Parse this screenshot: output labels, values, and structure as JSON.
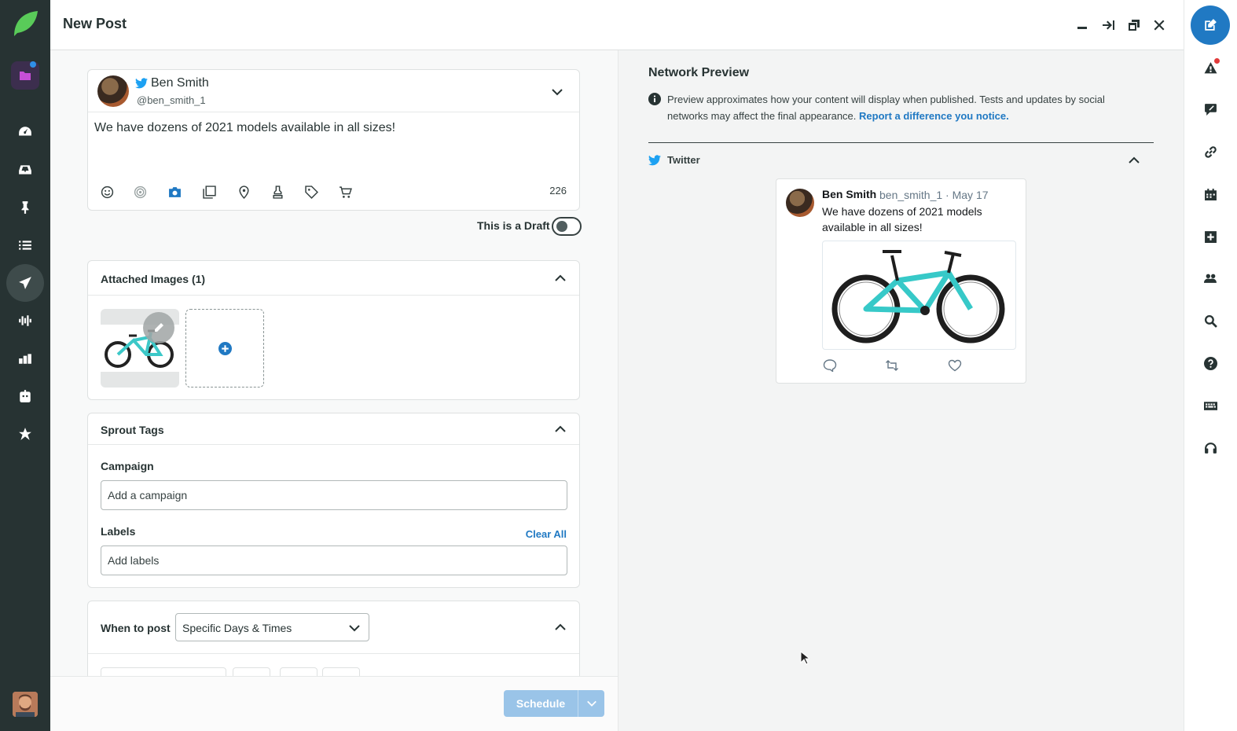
{
  "app": {
    "title": "New Post"
  },
  "composer": {
    "account_name": "Ben Smith",
    "account_handle": "@ben_smith_1",
    "message": "We have dozens of 2021 models available in all sizes!",
    "char_count": "226"
  },
  "draft": {
    "label": "This is a Draft",
    "enabled": false
  },
  "attached_images": {
    "title": "Attached Images",
    "count_label": "(1)"
  },
  "sprout_tags": {
    "title": "Sprout Tags",
    "campaign_label": "Campaign",
    "campaign_placeholder": "Add a campaign",
    "labels_label": "Labels",
    "labels_placeholder": "Add labels",
    "clear_all": "Clear All"
  },
  "when_to_post": {
    "label": "When to post",
    "selected": "Specific Days & Times"
  },
  "footer": {
    "schedule_label": "Schedule"
  },
  "preview": {
    "title": "Network Preview",
    "note": "Preview approximates how your content will display when published. Tests and updates by social networks may affect the final appearance.",
    "note_link": "Report a difference you notice.",
    "network": "Twitter",
    "tweet": {
      "name": "Ben Smith",
      "handle_date": "ben_smith_1 · May 17",
      "text": "We have dozens of 2021 models available in all sizes!"
    }
  },
  "colors": {
    "nav_bg": "#273333",
    "accent": "#2079c3",
    "brand_green": "#59cb59",
    "schedule_disabled": "#9ac4e8"
  }
}
